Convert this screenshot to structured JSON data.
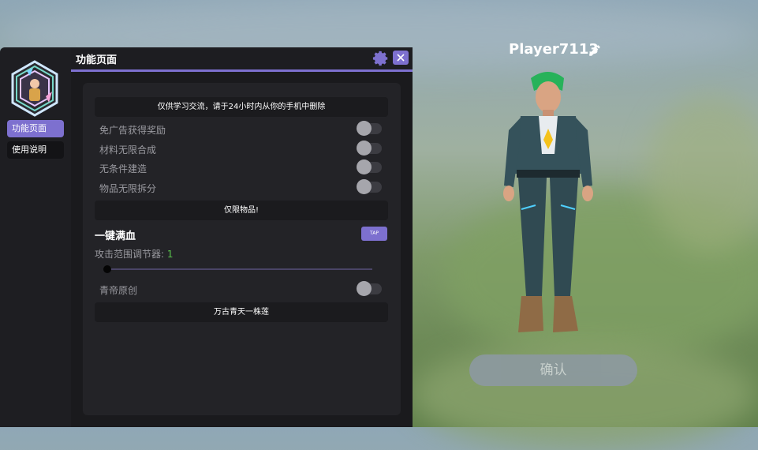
{
  "sidebar": {
    "items": [
      {
        "label": "功能页面",
        "active": true
      },
      {
        "label": "使用说明",
        "active": false
      }
    ]
  },
  "panel": {
    "title": "功能页面",
    "notice": "仅供学习交流，请于24小时内从你的手机中删除",
    "toggles": [
      {
        "label": "免广告获得奖励",
        "on": false
      },
      {
        "label": "材料无限合成",
        "on": false
      },
      {
        "label": "无条件建造",
        "on": false
      },
      {
        "label": "物品无限拆分",
        "on": false
      }
    ],
    "items_only_banner": "仅限物品!",
    "full_health": {
      "label": "一键满血",
      "button": "TAP"
    },
    "attack_range": {
      "label": "攻击范围调节器: ",
      "value": "1",
      "slider_fraction": 0.0
    },
    "credit_toggle": {
      "label": "青帝原创",
      "on": false
    },
    "footer_banner": "万古青天一株莲"
  },
  "player": {
    "name": "Player7113"
  },
  "confirm_button": "确认",
  "colors": {
    "accent": "#7d70cf",
    "panel_bg": "#1a1a1d",
    "value_green": "#58c04a"
  },
  "icons": [
    "hexagon-avatar-icon",
    "gear-icon",
    "close-icon",
    "pencil-icon"
  ]
}
